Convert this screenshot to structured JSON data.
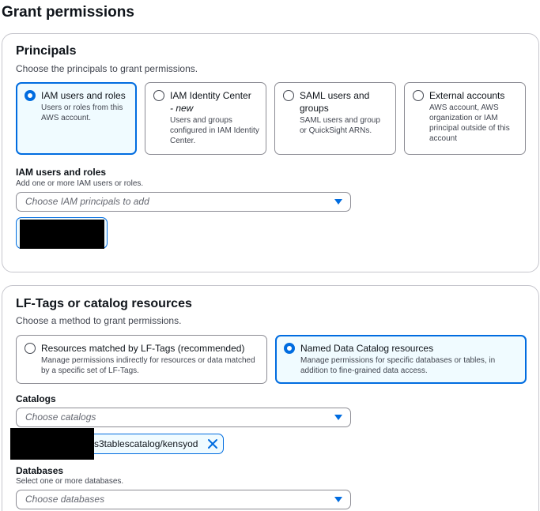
{
  "page": {
    "title": "Grant permissions"
  },
  "principals": {
    "title": "Principals",
    "description": "Choose the principals to grant permissions.",
    "options": [
      {
        "title": "IAM users and roles",
        "desc": "Users or roles from this AWS account.",
        "selected": true
      },
      {
        "title": "IAM Identity Center",
        "badge": "- new",
        "desc": "Users and groups configured in IAM Identity Center.",
        "selected": false
      },
      {
        "title": "SAML users and groups",
        "desc": "SAML users and group or QuickSight ARNs.",
        "selected": false
      },
      {
        "title": "External accounts",
        "desc": "AWS account, AWS organization or IAM principal outside of this account",
        "selected": false
      }
    ],
    "iam": {
      "label": "IAM users and roles",
      "hint": "Add one or more IAM users or roles.",
      "placeholder": "Choose IAM principals to add"
    }
  },
  "lf": {
    "title": "LF-Tags or catalog resources",
    "description": "Choose a method to grant permissions.",
    "options": [
      {
        "title": "Resources matched by LF-Tags (recommended)",
        "desc": "Manage permissions indirectly for resources or data matched by a specific set of LF-Tags.",
        "selected": false
      },
      {
        "title": "Named Data Catalog resources",
        "desc": "Manage permissions for specific databases or tables, in addition to fine-grained data access.",
        "selected": true
      }
    ],
    "catalogs": {
      "label": "Catalogs",
      "placeholder": "Choose catalogs",
      "token": "s3tablescatalog/kensyod"
    },
    "databases": {
      "label": "Databases",
      "hint": "Select one or more databases.",
      "placeholder": "Choose databases"
    }
  },
  "colors": {
    "accent": "#006ce0",
    "selected_bg": "#f0fbff",
    "border": "#8c8c94"
  }
}
